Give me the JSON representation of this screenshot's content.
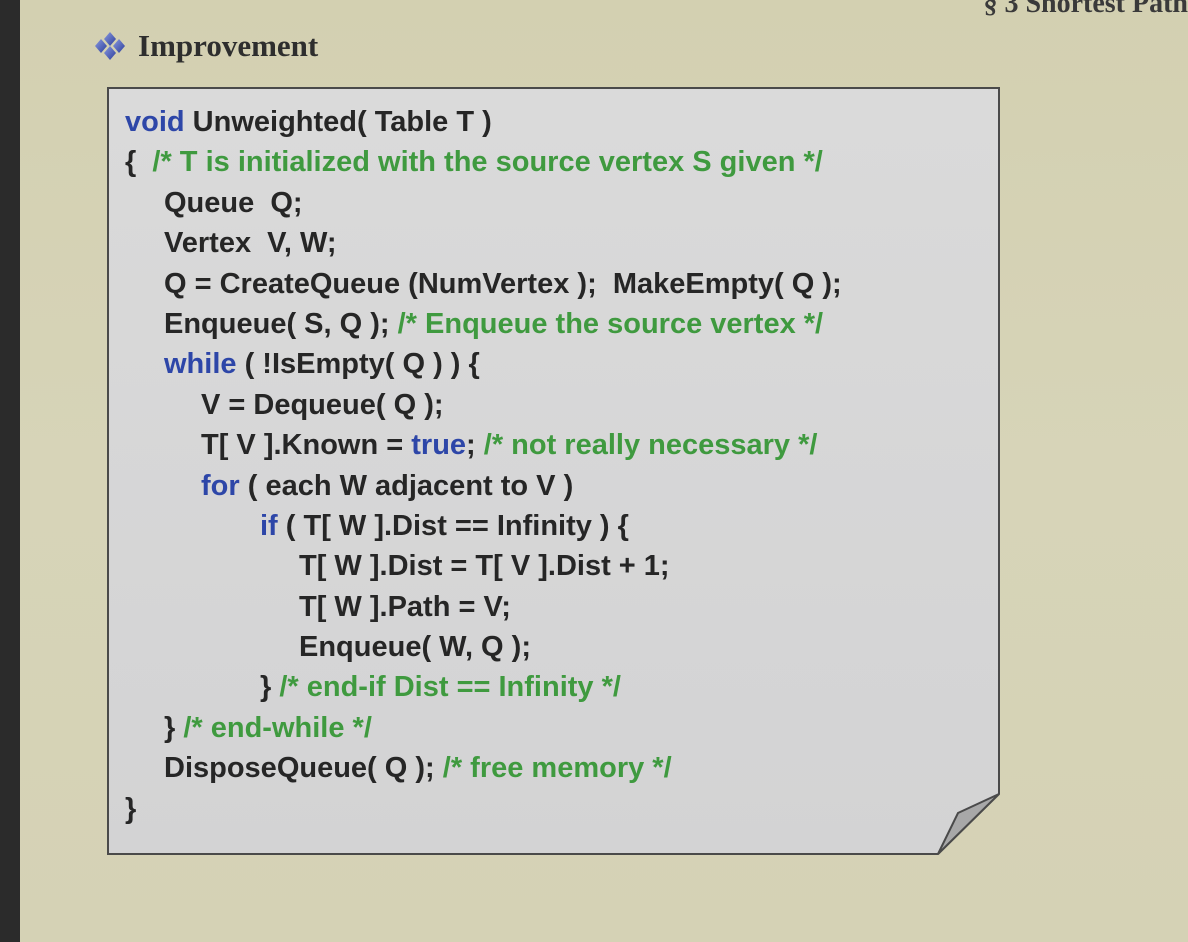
{
  "slide": {
    "section_label": "§ 3  Shortest Path",
    "heading": "Improvement",
    "heading_icon": "diamond-bullet-icon"
  },
  "code": {
    "lines": [
      {
        "indent": 0,
        "parts": [
          {
            "t": "void",
            "c": "kw"
          },
          {
            "t": " Unweighted( Table T )",
            "c": "tx"
          }
        ]
      },
      {
        "indent": 0,
        "parts": [
          {
            "t": "{  ",
            "c": "tx"
          },
          {
            "t": "/* T is initialized with the source vertex S given */",
            "c": "cm"
          }
        ]
      },
      {
        "indent": 1,
        "parts": [
          {
            "t": "Queue  Q;",
            "c": "tx"
          }
        ]
      },
      {
        "indent": 1,
        "parts": [
          {
            "t": "Vertex  V, W;",
            "c": "tx"
          }
        ]
      },
      {
        "indent": 1,
        "parts": [
          {
            "t": "Q = CreateQueue (NumVertex );  MakeEmpty( Q );",
            "c": "tx"
          }
        ]
      },
      {
        "indent": 1,
        "parts": [
          {
            "t": "Enqueue( S, Q ); ",
            "c": "tx"
          },
          {
            "t": "/* Enqueue the source vertex */",
            "c": "cm"
          }
        ]
      },
      {
        "indent": 1,
        "parts": [
          {
            "t": "while",
            "c": "kw"
          },
          {
            "t": " ( !IsEmpty( Q ) ) {",
            "c": "tx"
          }
        ]
      },
      {
        "indent": 2,
        "parts": [
          {
            "t": "V = Dequeue( Q );",
            "c": "tx"
          }
        ]
      },
      {
        "indent": 2,
        "parts": [
          {
            "t": "T[ V ].Known = ",
            "c": "tx"
          },
          {
            "t": "true",
            "c": "kw"
          },
          {
            "t": "; ",
            "c": "tx"
          },
          {
            "t": "/* not really necessary */",
            "c": "cm"
          }
        ]
      },
      {
        "indent": 2,
        "parts": [
          {
            "t": "for",
            "c": "kw"
          },
          {
            "t": " ( each W adjacent to V )",
            "c": "tx"
          }
        ]
      },
      {
        "indent": 3,
        "parts": [
          {
            "t": "if",
            "c": "kw"
          },
          {
            "t": " ( T[ W ].Dist == Infinity ) {",
            "c": "tx"
          }
        ]
      },
      {
        "indent": 4,
        "parts": [
          {
            "t": "T[ W ].Dist = T[ V ].Dist + 1;",
            "c": "tx"
          }
        ]
      },
      {
        "indent": 4,
        "parts": [
          {
            "t": "T[ W ].Path = V;",
            "c": "tx"
          }
        ]
      },
      {
        "indent": 4,
        "parts": [
          {
            "t": "Enqueue( W, Q );",
            "c": "tx"
          }
        ]
      },
      {
        "indent": 3,
        "parts": [
          {
            "t": "} ",
            "c": "tx"
          },
          {
            "t": "/* end-if Dist == Infinity */",
            "c": "cm"
          }
        ]
      },
      {
        "indent": 1,
        "parts": [
          {
            "t": "} ",
            "c": "tx"
          },
          {
            "t": "/* end-while */",
            "c": "cm"
          }
        ]
      },
      {
        "indent": 1,
        "parts": [
          {
            "t": "DisposeQueue( Q ); ",
            "c": "tx"
          },
          {
            "t": "/* free memory */",
            "c": "cm"
          }
        ]
      },
      {
        "indent": 0,
        "parts": [
          {
            "t": "}",
            "c": "tx"
          }
        ]
      }
    ]
  },
  "colors": {
    "background": "#d6d3b6",
    "keyword": "#2d46a8",
    "comment": "#3f9a3f",
    "text": "#262626",
    "box_fill": "#d9d8d8"
  }
}
